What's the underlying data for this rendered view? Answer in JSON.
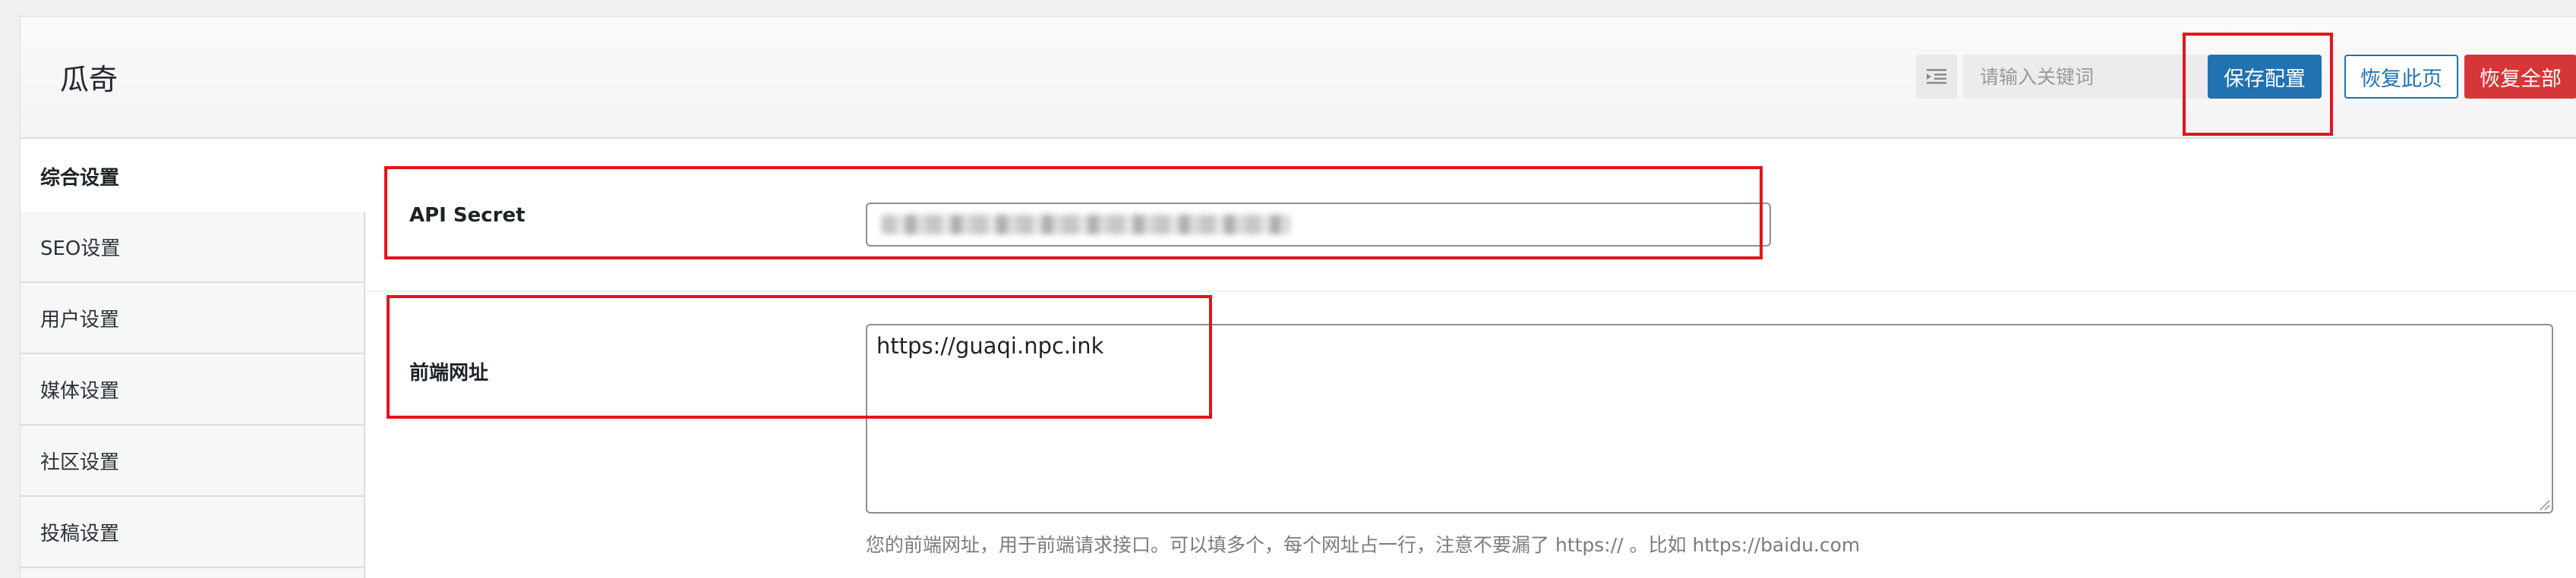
{
  "header": {
    "title": "瓜奇",
    "search_placeholder": "请输入关键词",
    "save_label": "保存配置",
    "restore_page_label": "恢复此页",
    "restore_all_label": "恢复全部"
  },
  "sidebar": {
    "items": [
      {
        "label": "综合设置",
        "active": true
      },
      {
        "label": "SEO设置",
        "active": false
      },
      {
        "label": "用户设置",
        "active": false
      },
      {
        "label": "媒体设置",
        "active": false
      },
      {
        "label": "社区设置",
        "active": false
      },
      {
        "label": "投稿设置",
        "active": false
      }
    ]
  },
  "fields": {
    "api_secret": {
      "label": "API Secret"
    },
    "frontend_url": {
      "label": "前端网址",
      "value": "https://guaqi.npc.ink",
      "help": "您的前端网址，用于前端请求接口。可以填多个，每个网址占一行，注意不要漏了 https:// 。比如 https://baidu.com"
    }
  },
  "colors": {
    "primary": "#2271b1",
    "danger": "#d63638",
    "highlight": "#e3141c"
  },
  "icons": {
    "collapse": "outdent-icon"
  }
}
